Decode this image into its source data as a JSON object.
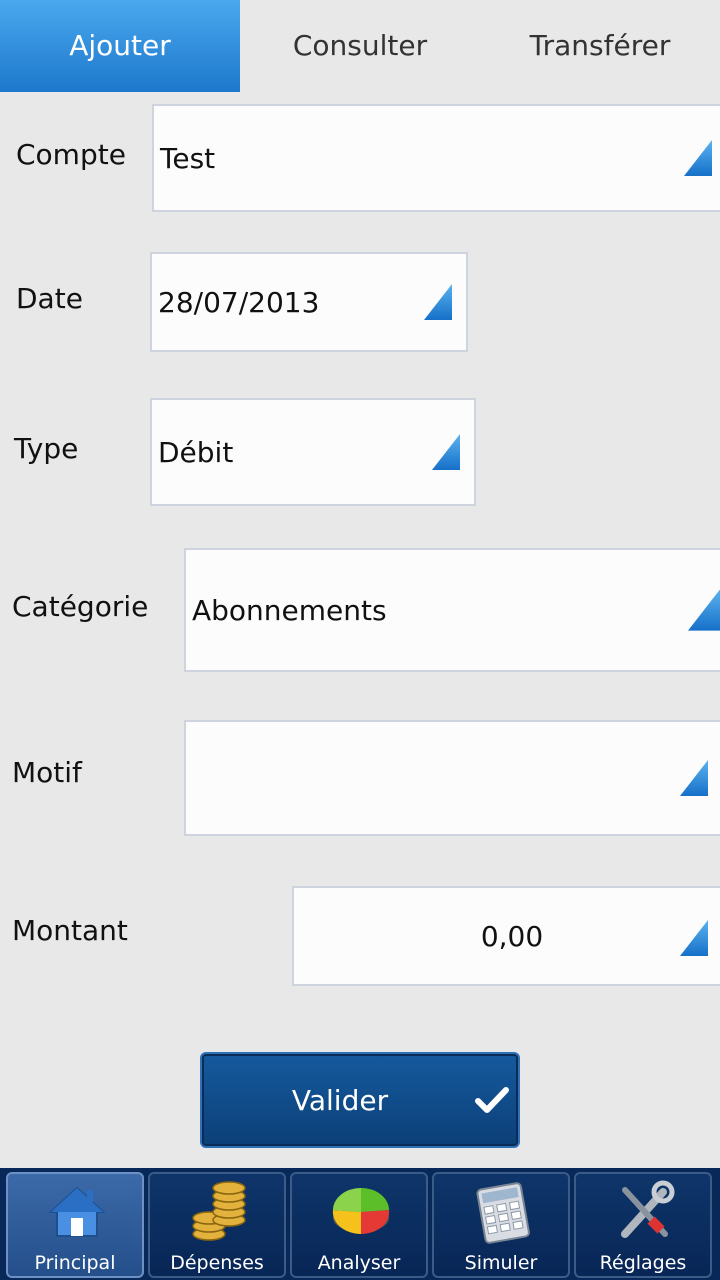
{
  "tabs": {
    "add": "Ajouter",
    "view": "Consulter",
    "transfer": "Transférer"
  },
  "form": {
    "account": {
      "label": "Compte",
      "value": "Test"
    },
    "date": {
      "label": "Date",
      "value": "28/07/2013"
    },
    "type": {
      "label": "Type",
      "value": "Débit"
    },
    "category": {
      "label": "Catégorie",
      "value": "Abonnements"
    },
    "reason": {
      "label": "Motif",
      "value": ""
    },
    "amount": {
      "label": "Montant",
      "value": "0,00"
    }
  },
  "submit": {
    "label": "Valider",
    "icon": "checkmark-icon"
  },
  "bottom_nav": {
    "main": {
      "label": "Principal",
      "icon": "house-icon"
    },
    "expenses": {
      "label": "Dépenses",
      "icon": "coins-icon"
    },
    "analyze": {
      "label": "Analyser",
      "icon": "pie-chart-icon"
    },
    "simulate": {
      "label": "Simuler",
      "icon": "calculator-icon"
    },
    "settings": {
      "label": "Réglages",
      "icon": "tools-icon"
    }
  },
  "colors": {
    "accent": "#1d78cc",
    "nav_bg": "#08285a",
    "button_bg": "#0c3f77"
  }
}
